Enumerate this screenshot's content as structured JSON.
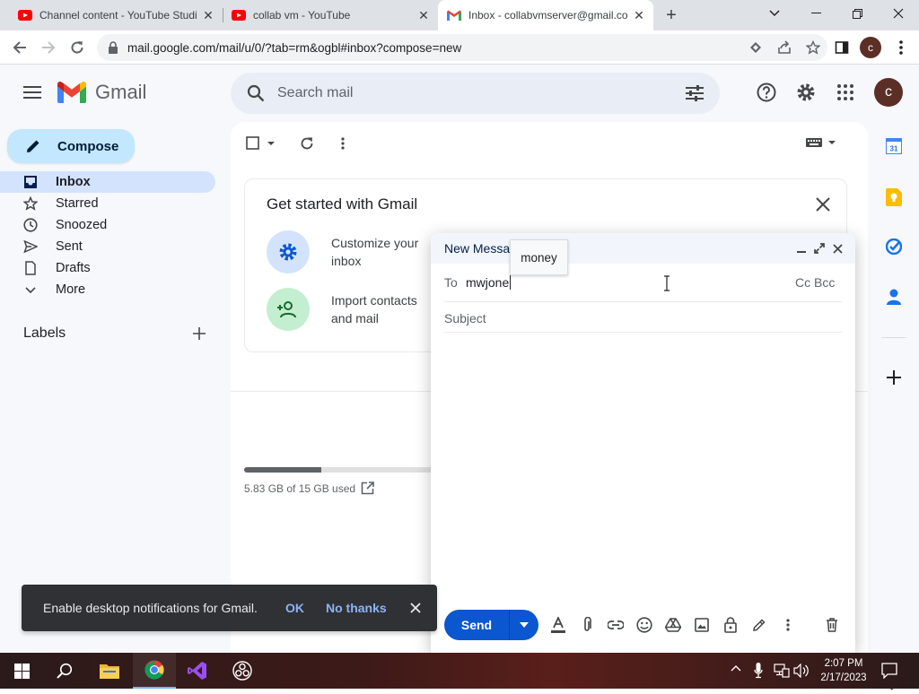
{
  "browser": {
    "tabs": [
      {
        "title": "Channel content - YouTube Studio",
        "icon": "youtube-icon",
        "active": false
      },
      {
        "title": "collab vm - YouTube",
        "icon": "youtube-icon",
        "active": false
      },
      {
        "title": "Inbox - collabvmserver@gmail.com",
        "icon": "gmail-icon",
        "active": true
      }
    ],
    "url": "mail.google.com/mail/u/0/?tab=rm&ogbl#inbox?compose=new",
    "profile_initial": "c"
  },
  "gmail": {
    "logo_text": "Gmail",
    "search_placeholder": "Search mail",
    "account_initial": "c",
    "compose_label": "Compose",
    "nav": [
      {
        "label": "Inbox",
        "icon": "inbox-icon",
        "selected": true
      },
      {
        "label": "Starred",
        "icon": "star-icon"
      },
      {
        "label": "Snoozed",
        "icon": "clock-icon"
      },
      {
        "label": "Sent",
        "icon": "send-icon"
      },
      {
        "label": "Drafts",
        "icon": "draft-icon"
      },
      {
        "label": "More",
        "icon": "chevron-down-icon"
      }
    ],
    "labels_heading": "Labels",
    "get_started": {
      "title": "Get started with Gmail",
      "items": [
        {
          "text": "Customize your inbox",
          "icon": "gear-icon"
        },
        {
          "text": "Import contacts and mail",
          "icon": "add-person-icon"
        }
      ]
    },
    "storage": {
      "text": "5.83 GB of 15 GB used",
      "used_fraction": 0.39
    }
  },
  "compose_window": {
    "title": "New Message",
    "tooltip": "money",
    "to_label": "To",
    "to_value": "mwjone",
    "cc_bcc": "Cc Bcc",
    "subject_placeholder": "Subject",
    "send_label": "Send"
  },
  "toast": {
    "message": "Enable desktop notifications for Gmail.",
    "ok": "OK",
    "no_thanks": "No thanks"
  },
  "taskbar": {
    "time": "2:07 PM",
    "date": "2/17/2023"
  },
  "colors": {
    "accent": "#0b57d0",
    "compose_bg": "#c2e7ff",
    "selected_nav": "#d3e3fd",
    "gmail_red": "#ea4335"
  }
}
